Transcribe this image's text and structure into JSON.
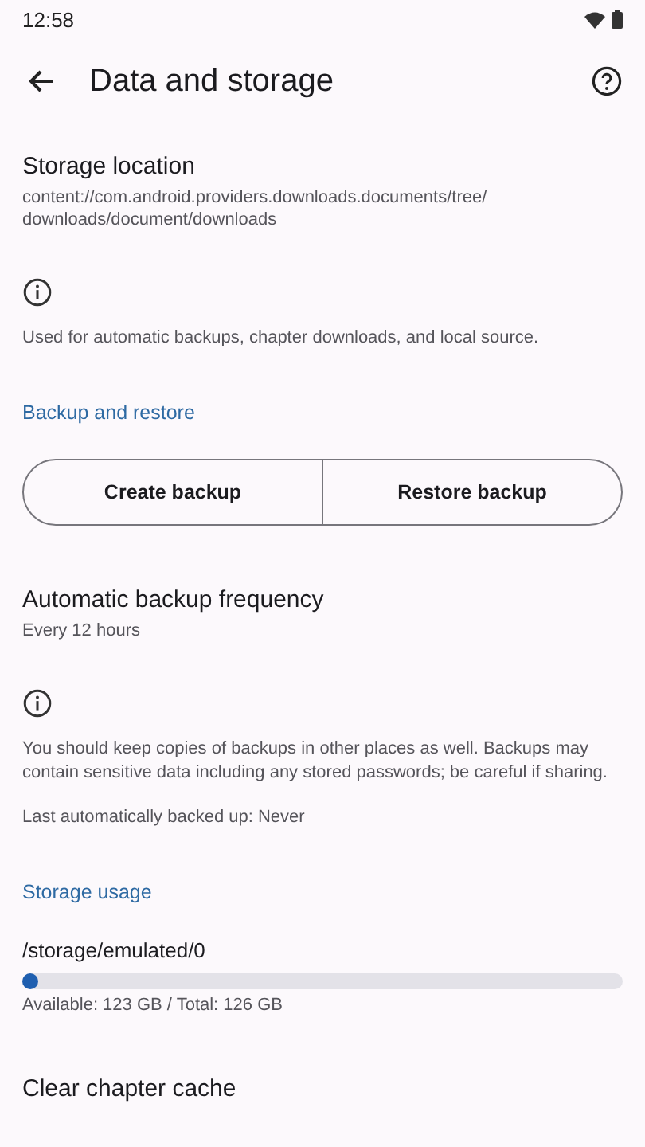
{
  "status_bar": {
    "time": "12:58"
  },
  "app_bar": {
    "title": "Data and storage"
  },
  "items": [
    {
      "kind": "pref",
      "title": "Storage location",
      "subtitle": "content://com.android.providers.downloads.documents/tree/downloads/document/downloads"
    },
    {
      "kind": "info",
      "text": "Used for automatic backups, chapter downloads, and local source."
    },
    {
      "kind": "header",
      "text": "Backup and restore"
    },
    {
      "kind": "buttons",
      "buttons": [
        "Create backup",
        "Restore backup"
      ]
    },
    {
      "kind": "pref",
      "title": "Automatic backup frequency",
      "subtitle": "Every 12 hours"
    },
    {
      "kind": "info",
      "text": "You should keep copies of backups in other places as well. Backups may contain sensitive data including any stored passwords; be careful if sharing.",
      "extra": "Last automatically backed up: Never"
    },
    {
      "kind": "header",
      "text": "Storage usage"
    },
    {
      "kind": "storage",
      "path": "/storage/emulated/0",
      "level": 0.024,
      "summary": "Available: 123 GB / Total: 126 GB"
    },
    {
      "kind": "pref",
      "title": "Clear chapter cache"
    }
  ]
}
